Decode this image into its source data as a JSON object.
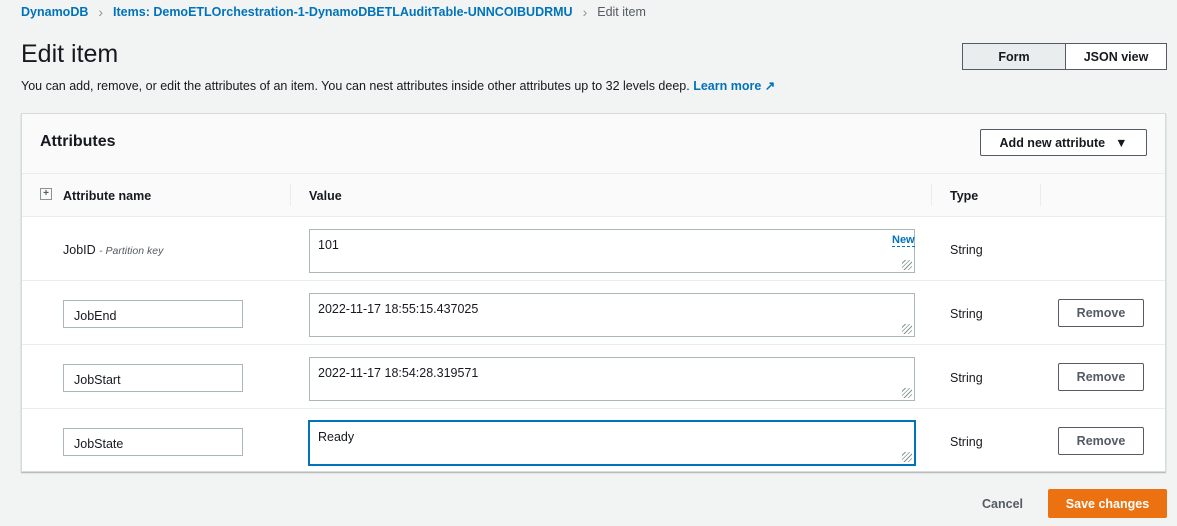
{
  "breadcrumb": [
    "DynamoDB",
    "Items: DemoETLOrchestration-1-DynamoDBETLAuditTable-UNNCOIBUDRMU",
    "Edit item"
  ],
  "title": "Edit item",
  "description": "You can add, remove, or edit the attributes of an item. You can nest attributes inside other attributes up to 32 levels deep.",
  "learn_more": "Learn more",
  "view_toggle": {
    "form": "Form",
    "json": "JSON view"
  },
  "panel": {
    "title": "Attributes",
    "add_button": "Add new attribute"
  },
  "columns": {
    "name": "Attribute name",
    "value": "Value",
    "type": "Type"
  },
  "rows": [
    {
      "name": "JobID",
      "key_label": "- Partition key",
      "value": "101",
      "type": "String",
      "badge": "New"
    },
    {
      "name": "JobEnd",
      "value": "2022-11-17 18:55:15.437025",
      "type": "String",
      "remove": "Remove"
    },
    {
      "name": "JobStart",
      "value": "2022-11-17 18:54:28.319571",
      "type": "String",
      "remove": "Remove"
    },
    {
      "name": "JobState",
      "value": "Ready",
      "type": "String",
      "remove": "Remove"
    }
  ],
  "footer": {
    "cancel": "Cancel",
    "save": "Save changes"
  }
}
